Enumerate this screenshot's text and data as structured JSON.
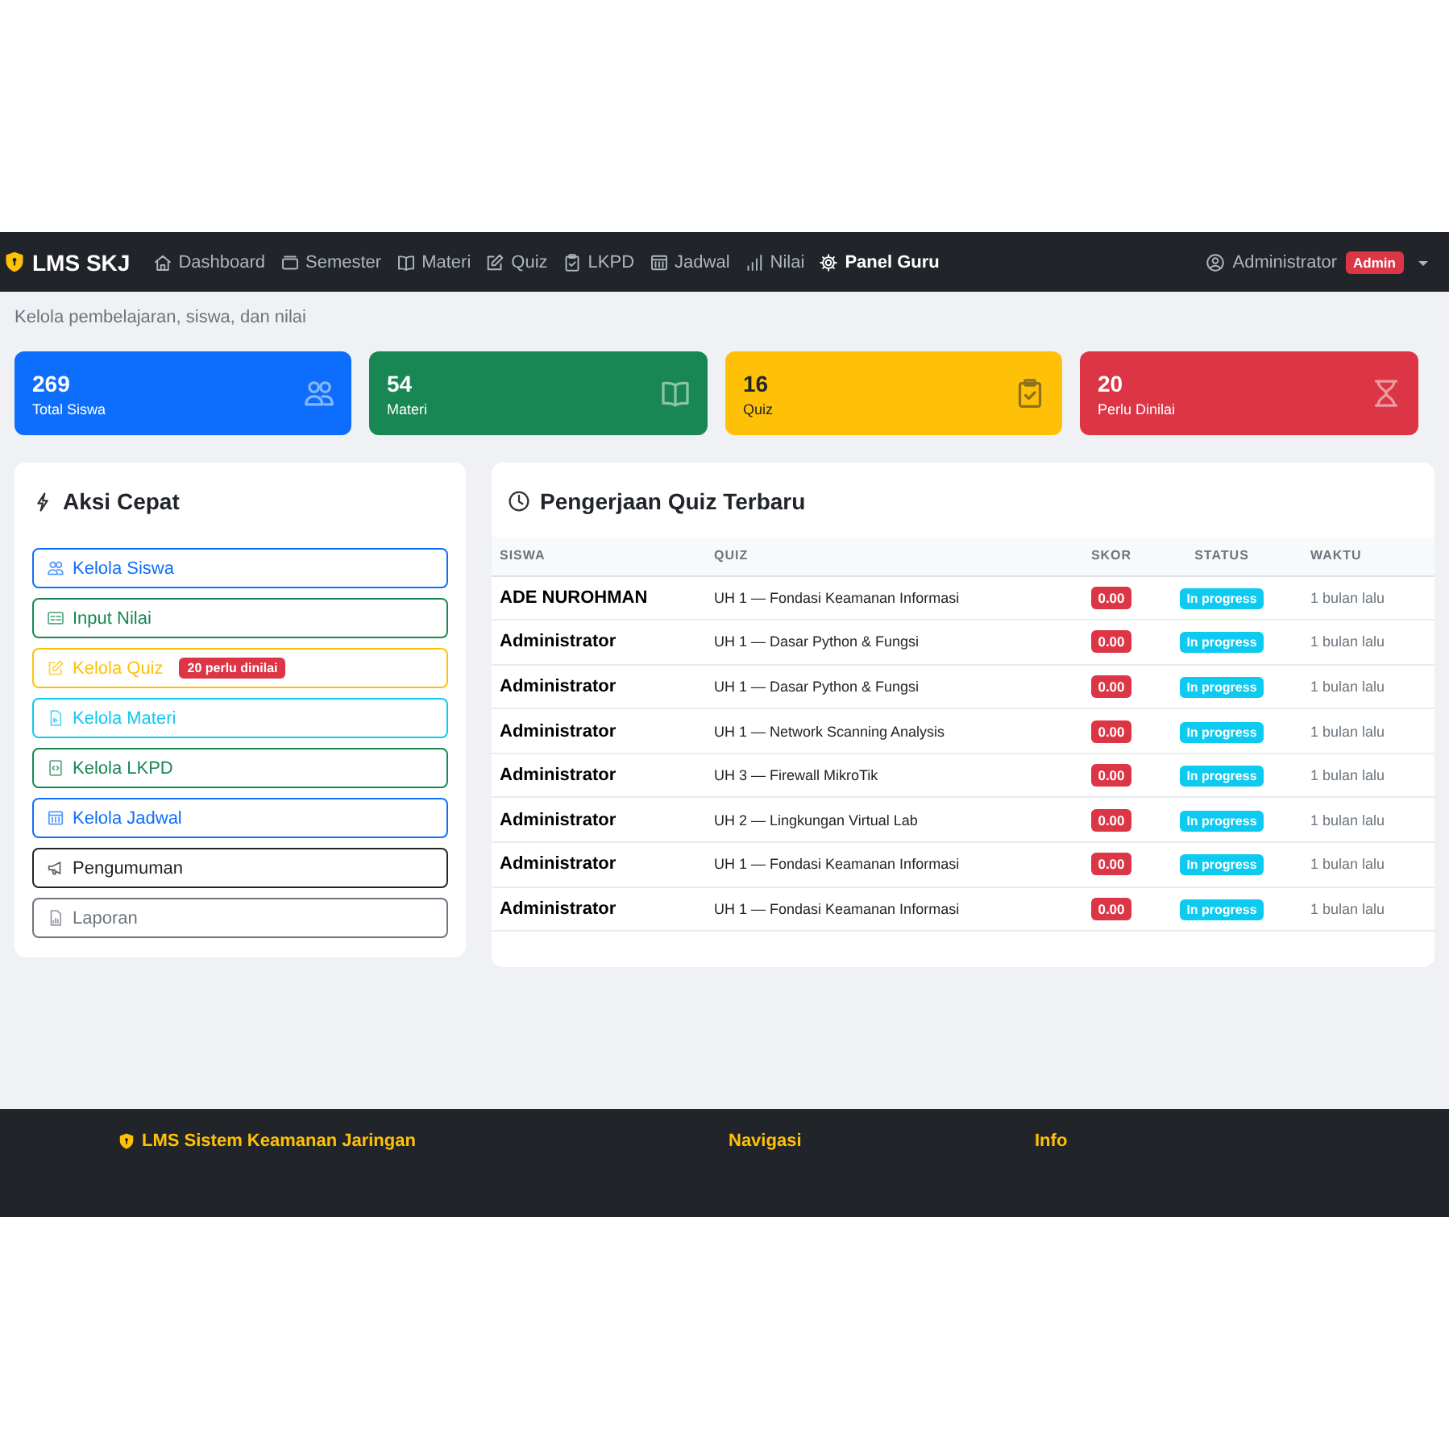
{
  "navbar": {
    "brand": "LMS SKJ",
    "items": [
      {
        "kind": "home",
        "label": "Dashboard",
        "selected": false
      },
      {
        "kind": "box",
        "label": "Semester",
        "selected": false
      },
      {
        "kind": "book",
        "label": "Materi",
        "selected": false
      },
      {
        "kind": "edit",
        "label": "Quiz",
        "selected": false
      },
      {
        "kind": "clipboard",
        "label": "LKPD",
        "selected": false
      },
      {
        "kind": "table",
        "label": "Jadwal",
        "selected": false
      },
      {
        "kind": "bars",
        "label": "Nilai",
        "selected": false
      },
      {
        "kind": "gear",
        "label": "Panel Guru",
        "selected": true
      }
    ],
    "user": {
      "name": "Administrator",
      "badge": "Admin"
    }
  },
  "page": {
    "subtitle": "Kelola pembelajaran, siswa, dan nilai"
  },
  "stats": [
    {
      "value": "269",
      "label": "Total Siswa",
      "color": "#0d6efd",
      "kind": "people"
    },
    {
      "value": "54",
      "label": "Materi",
      "color": "#198754",
      "kind": "book"
    },
    {
      "value": "16",
      "label": "Quiz",
      "color": "#ffc107",
      "kind": "clipboard"
    },
    {
      "value": "20",
      "label": "Perlu Dinilai",
      "color": "#dc3545",
      "kind": "hourglass"
    }
  ],
  "quick_actions": {
    "title": "Aksi Cepat",
    "items": [
      {
        "label": "Kelola Siswa",
        "color": "#0d6efd",
        "kind": "people"
      },
      {
        "label": "Input Nilai",
        "color": "#198754",
        "kind": "card"
      },
      {
        "label": "Kelola Quiz",
        "color": "#ffc107",
        "kind": "edit",
        "badge": "20 perlu dinilai"
      },
      {
        "label": "Kelola Materi",
        "color": "#0dcaf0",
        "kind": "file"
      },
      {
        "label": "Kelola LKPD",
        "color": "#198754",
        "kind": "code"
      },
      {
        "label": "Kelola Jadwal",
        "color": "#0d6efd",
        "kind": "table"
      },
      {
        "label": "Pengumuman",
        "color": "#212529",
        "kind": "megaphone"
      },
      {
        "label": "Laporan",
        "color": "#6c757d",
        "kind": "report"
      }
    ]
  },
  "recent_quiz": {
    "title": "Pengerjaan Quiz Terbaru",
    "columns": [
      "SISWA",
      "QUIZ",
      "SKOR",
      "STATUS",
      "WAKTU"
    ],
    "rows": [
      {
        "student": "ADE NUROHMAN",
        "quiz": "UH 1 — Fondasi Keamanan Informasi",
        "score": "0.00",
        "status": "In progress",
        "time": "1 bulan lalu"
      },
      {
        "student": "Administrator",
        "quiz": "UH 1 — Dasar Python & Fungsi",
        "score": "0.00",
        "status": "In progress",
        "time": "1 bulan lalu"
      },
      {
        "student": "Administrator",
        "quiz": "UH 1 — Dasar Python & Fungsi",
        "score": "0.00",
        "status": "In progress",
        "time": "1 bulan lalu"
      },
      {
        "student": "Administrator",
        "quiz": "UH 1 — Network Scanning Analysis",
        "score": "0.00",
        "status": "In progress",
        "time": "1 bulan lalu"
      },
      {
        "student": "Administrator",
        "quiz": "UH 3 — Firewall MikroTik",
        "score": "0.00",
        "status": "In progress",
        "time": "1 bulan lalu"
      },
      {
        "student": "Administrator",
        "quiz": "UH 2 — Lingkungan Virtual Lab",
        "score": "0.00",
        "status": "In progress",
        "time": "1 bulan lalu"
      },
      {
        "student": "Administrator",
        "quiz": "UH 1 — Fondasi Keamanan Informasi",
        "score": "0.00",
        "status": "In progress",
        "time": "1 bulan lalu"
      },
      {
        "student": "Administrator",
        "quiz": "UH 1 — Fondasi Keamanan Informasi",
        "score": "0.00",
        "status": "In progress",
        "time": "1 bulan lalu"
      }
    ]
  },
  "footer": {
    "brand": "LMS Sistem Keamanan Jaringan",
    "headings": [
      "Navigasi",
      "Info"
    ]
  }
}
